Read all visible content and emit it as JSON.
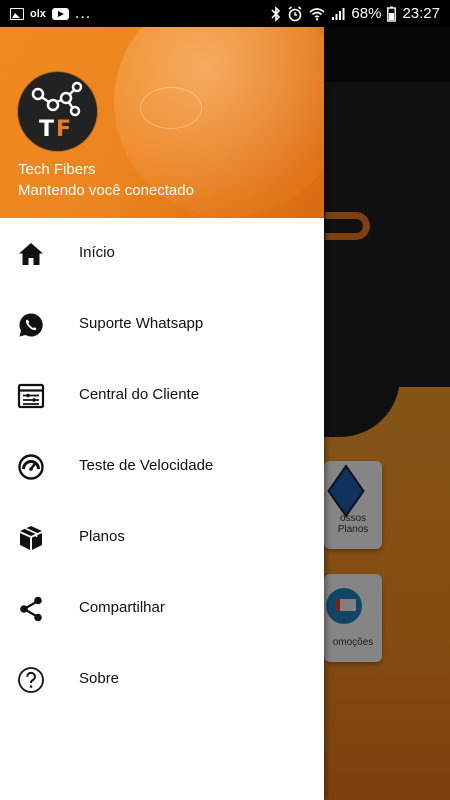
{
  "status_bar": {
    "left_icons": [
      "image-icon",
      "olx-icon",
      "youtube-icon",
      "more-icon"
    ],
    "olx_text": "olx",
    "more_text": "...",
    "battery": "68%",
    "time": "23:27"
  },
  "drawer": {
    "header": {
      "logo_text": "TF",
      "title": "Tech Fibers",
      "subtitle": "Mantendo você conectado"
    },
    "items": [
      {
        "label": "Início",
        "icon": "home-icon"
      },
      {
        "label": "Suporte Whatsapp",
        "icon": "whatsapp-icon"
      },
      {
        "label": "Central do Cliente",
        "icon": "client-panel-icon"
      },
      {
        "label": "Teste de Velocidade",
        "icon": "speedometer-icon"
      },
      {
        "label": "Planos",
        "icon": "package-icon"
      },
      {
        "label": "Compartilhar",
        "icon": "share-icon"
      },
      {
        "label": "Sobre",
        "icon": "help-icon"
      }
    ]
  },
  "background": {
    "card1": {
      "line1": "ossos",
      "line2": "Planos"
    },
    "card2": {
      "line1": "omoções"
    }
  },
  "colors": {
    "accent": "#ef8a1f",
    "drawer_bg": "#ffffff",
    "text": "#111111"
  }
}
